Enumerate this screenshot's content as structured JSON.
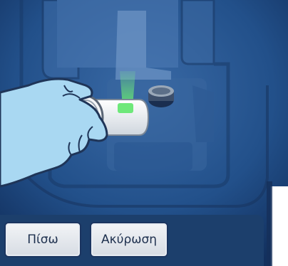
{
  "buttons": {
    "back_label": "Πίσω",
    "cancel_label": "Ακύρωση"
  },
  "illustration": {
    "description_icon": "hand-inserting-cartridge-illustration",
    "indicator_light_color": "#6ee87a"
  },
  "colors": {
    "background_dark": "#112a55",
    "background_mid": "#24558f",
    "button_bar": "#1c3f6c",
    "glove": "#a9d8f2"
  }
}
